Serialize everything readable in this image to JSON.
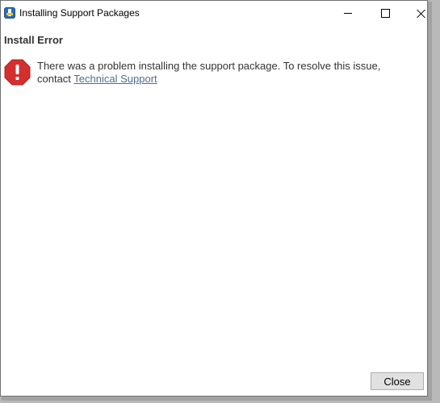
{
  "window": {
    "title": "Installing Support Packages"
  },
  "dialog": {
    "heading": "Install Error",
    "message_prefix": "There was a problem installing the support package. To resolve this issue, contact ",
    "link_text": "Technical Support",
    "close_label": "Close"
  },
  "colors": {
    "error_red": "#d32f2f",
    "link": "#4d6f8e",
    "text": "#333333"
  },
  "icons": {
    "app": "installer-icon",
    "status": "error-octagon-icon"
  }
}
